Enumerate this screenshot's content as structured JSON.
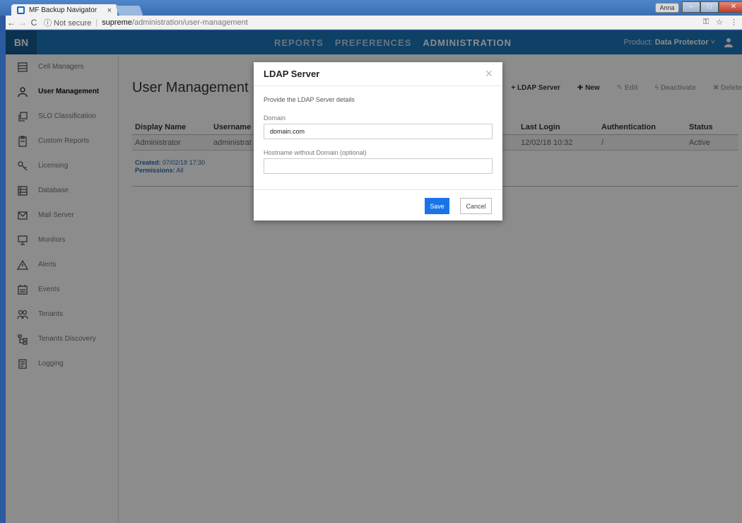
{
  "browser": {
    "tab_title": "MF Backup Navigator",
    "tab_close": "×",
    "window_user": "Anna",
    "security_label": "ⓘ Not secure",
    "url_host": "supreme",
    "url_path": "/administration/user-management"
  },
  "header": {
    "logo": "BN",
    "nav": [
      "REPORTS",
      "PREFERENCES",
      "ADMINISTRATION"
    ],
    "active_nav": "ADMINISTRATION",
    "product_label": "Product:",
    "product_value": "Data Protector"
  },
  "sidebar": {
    "items": [
      {
        "label": "Cell Managers",
        "icon": "server-icon"
      },
      {
        "label": "User Management",
        "icon": "user-icon",
        "active": true
      },
      {
        "label": "SLO Classification",
        "icon": "copy-icon"
      },
      {
        "label": "Custom Reports",
        "icon": "clipboard-icon"
      },
      {
        "label": "Licensing",
        "icon": "key-icon"
      },
      {
        "label": "Database",
        "icon": "database-icon"
      },
      {
        "label": "Mail Server",
        "icon": "mail-icon"
      },
      {
        "label": "Monitors",
        "icon": "monitor-icon"
      },
      {
        "label": "Alerts",
        "icon": "warning-icon"
      },
      {
        "label": "Events",
        "icon": "calendar-icon"
      },
      {
        "label": "Tenants",
        "icon": "users-icon"
      },
      {
        "label": "Tenants Discovery",
        "icon": "tree-icon"
      },
      {
        "label": "Logging",
        "icon": "log-icon"
      }
    ]
  },
  "main": {
    "title": "User Management",
    "actions": {
      "ldap": "LDAP Server",
      "new": "New",
      "edit": "Edit",
      "deactivate": "Deactivate",
      "delete": "Delete"
    },
    "columns": [
      "Display Name",
      "Username",
      "Last Login",
      "Authentication",
      "Status"
    ],
    "rows": [
      {
        "display_name": "Administrator",
        "username": "administrat",
        "last_login": "12/02/18 10:32",
        "authentication": "/",
        "status": "Active"
      }
    ],
    "details": {
      "created_label": "Created:",
      "created_value": "07/02/18 17:30",
      "permissions_label": "Permissions:",
      "permissions_value": "All"
    }
  },
  "modal": {
    "title": "LDAP Server",
    "close": "×",
    "help": "Provide the LDAP Server details",
    "domain_label": "Domain",
    "domain_value": "domain.com",
    "hostname_label": "Hostname without Domain (optional)",
    "hostname_value": "",
    "save": "Save",
    "cancel": "Cancel"
  }
}
